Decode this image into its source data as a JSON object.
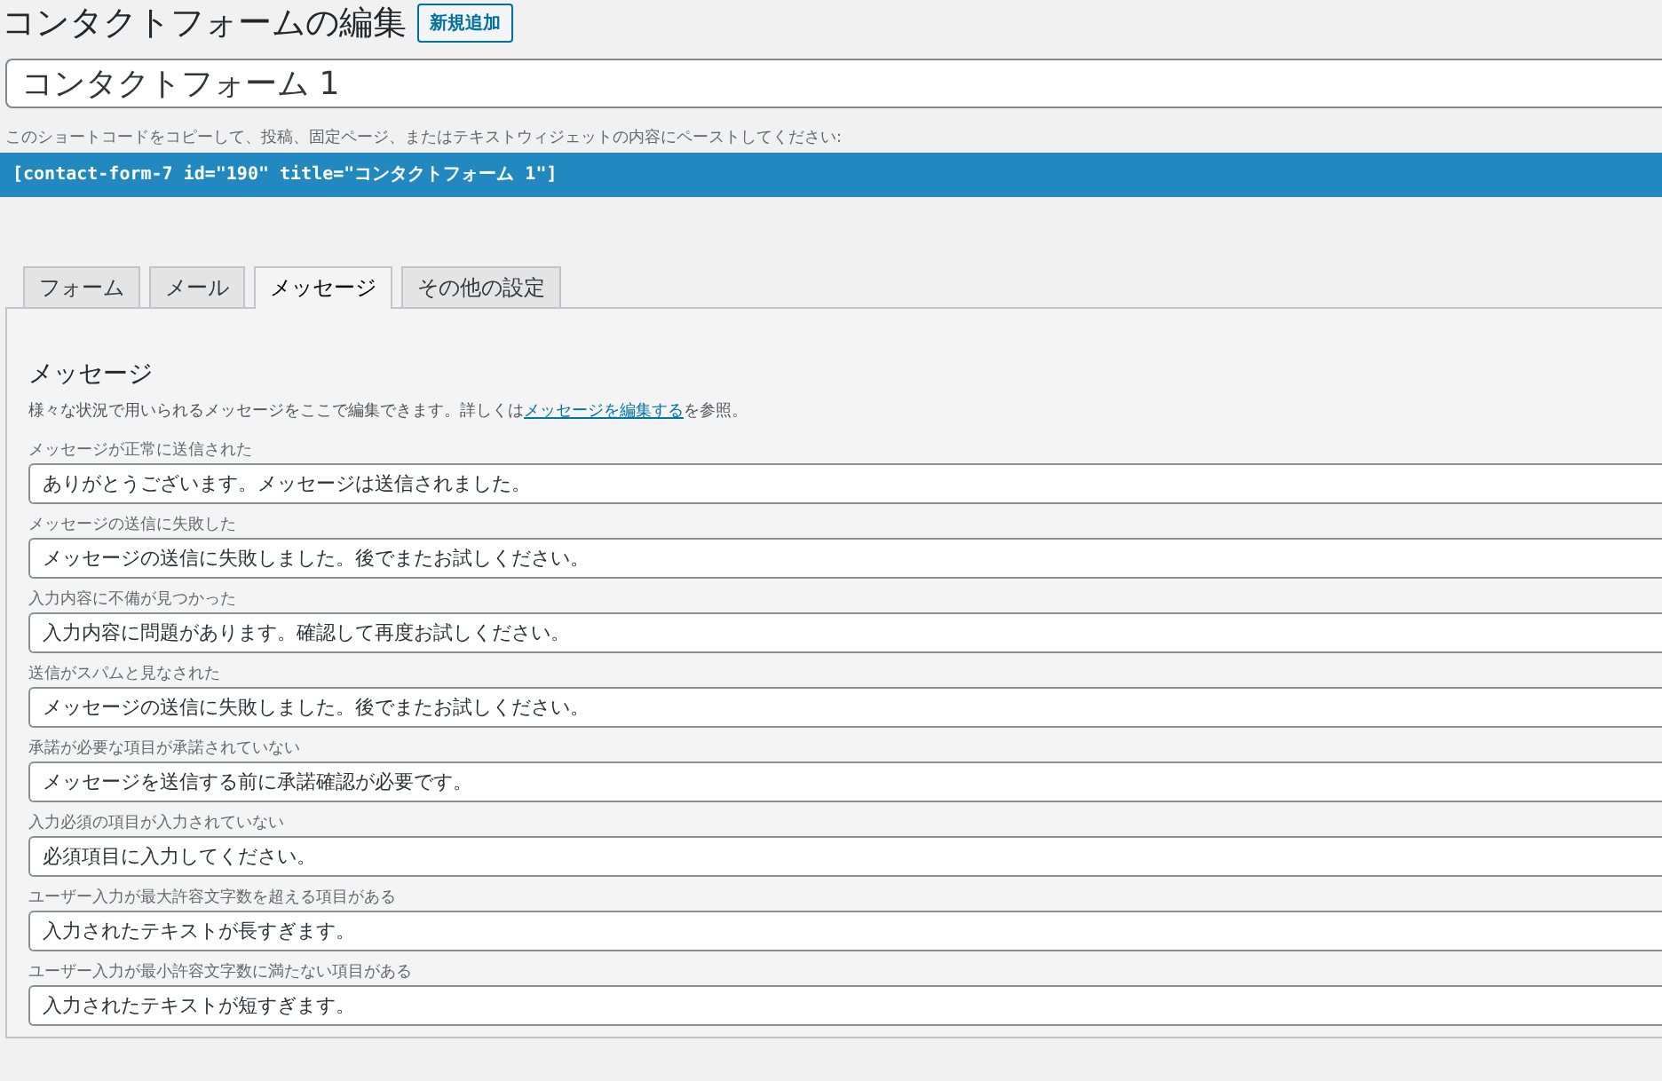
{
  "page": {
    "title": "コンタクトフォームの編集",
    "add_button": "新規追加"
  },
  "form_title": {
    "value": "コンタクトフォーム 1"
  },
  "shortcode": {
    "hint": "このショートコードをコピーして、投稿、固定ページ、またはテキストウィジェットの内容にペーストしてください:",
    "code": "[contact-form-7 id=\"190\" title=\"コンタクトフォーム 1\"]"
  },
  "tabs": [
    {
      "label": "フォーム",
      "selected": false
    },
    {
      "label": "メール",
      "selected": false
    },
    {
      "label": "メッセージ",
      "selected": true
    },
    {
      "label": "その他の設定",
      "selected": false
    }
  ],
  "panel": {
    "heading": "メッセージ",
    "description_before": "様々な状況で用いられるメッセージをここで編集できます。詳しくは",
    "description_link": "メッセージを編集する",
    "description_after": "を参照。",
    "messages": [
      {
        "label": "メッセージが正常に送信された",
        "value": "ありがとうございます。メッセージは送信されました。"
      },
      {
        "label": "メッセージの送信に失敗した",
        "value": "メッセージの送信に失敗しました。後でまたお試しください。"
      },
      {
        "label": "入力内容に不備が見つかった",
        "value": "入力内容に問題があります。確認して再度お試しください。"
      },
      {
        "label": "送信がスパムと見なされた",
        "value": "メッセージの送信に失敗しました。後でまたお試しください。"
      },
      {
        "label": "承諾が必要な項目が承諾されていない",
        "value": "メッセージを送信する前に承諾確認が必要です。"
      },
      {
        "label": "入力必須の項目が入力されていない",
        "value": "必須項目に入力してください。"
      },
      {
        "label": "ユーザー入力が最大許容文字数を超える項目がある",
        "value": "入力されたテキストが長すぎます。"
      },
      {
        "label": "ユーザー入力が最小許容文字数に満たない項目がある",
        "value": "入力されたテキストが短すぎます。"
      }
    ]
  }
}
